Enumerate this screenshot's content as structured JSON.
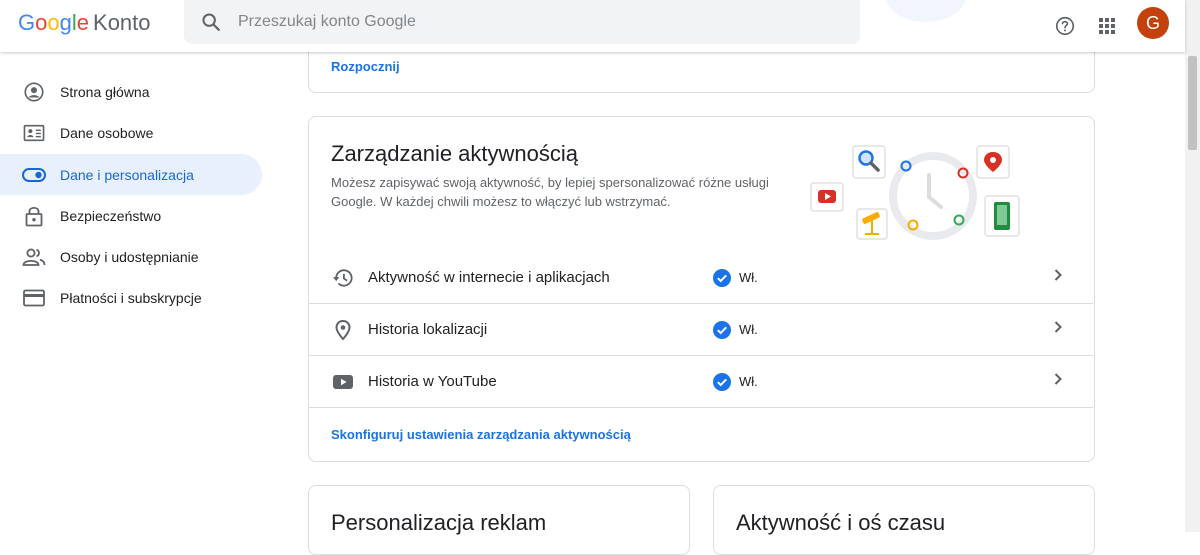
{
  "header": {
    "logo_letters": [
      {
        "ch": "G",
        "cls": "g-blue"
      },
      {
        "ch": "o",
        "cls": "g-red"
      },
      {
        "ch": "o",
        "cls": "g-yellow"
      },
      {
        "ch": "g",
        "cls": "g-blue"
      },
      {
        "ch": "l",
        "cls": "g-green"
      },
      {
        "ch": "e",
        "cls": "g-red"
      }
    ],
    "app_name": "Konto",
    "search_placeholder": "Przeszukaj konto Google",
    "avatar_letter": "G",
    "avatar_color": "#c2410c"
  },
  "sidebar": {
    "items": [
      {
        "label": "Strona główna",
        "icon": "account-circle-icon"
      },
      {
        "label": "Dane osobowe",
        "icon": "id-card-icon"
      },
      {
        "label": "Dane i personalizacja",
        "icon": "toggle-icon",
        "active": true
      },
      {
        "label": "Bezpieczeństwo",
        "icon": "lock-icon"
      },
      {
        "label": "Osoby i udostępnianie",
        "icon": "people-icon"
      },
      {
        "label": "Płatności i subskrypcje",
        "icon": "credit-card-icon"
      }
    ]
  },
  "top_card": {
    "link": "Rozpocznij"
  },
  "activity_card": {
    "title": "Zarządzanie aktywnością",
    "description": "Możesz zapisywać swoją aktywność, by lepiej spersonalizować różne usługi Google. W każdej chwili możesz to włączyć lub wstrzymać.",
    "rows": [
      {
        "label": "Aktywność w internecie i aplikacjach",
        "status": "Wł.",
        "icon": "history-icon"
      },
      {
        "label": "Historia lokalizacji",
        "status": "Wł.",
        "icon": "location-pin-icon"
      },
      {
        "label": "Historia w YouTube",
        "status": "Wł.",
        "icon": "youtube-icon"
      }
    ],
    "footer_link": "Skonfiguruj ustawienia zarządzania aktywnością"
  },
  "bottom_cards": {
    "left_title": "Personalizacja reklam",
    "right_title": "Aktywność i oś czasu"
  },
  "colors": {
    "accent": "#1a73e8",
    "active_bg": "#e8f0fe",
    "status_check": "#1a73e8"
  }
}
